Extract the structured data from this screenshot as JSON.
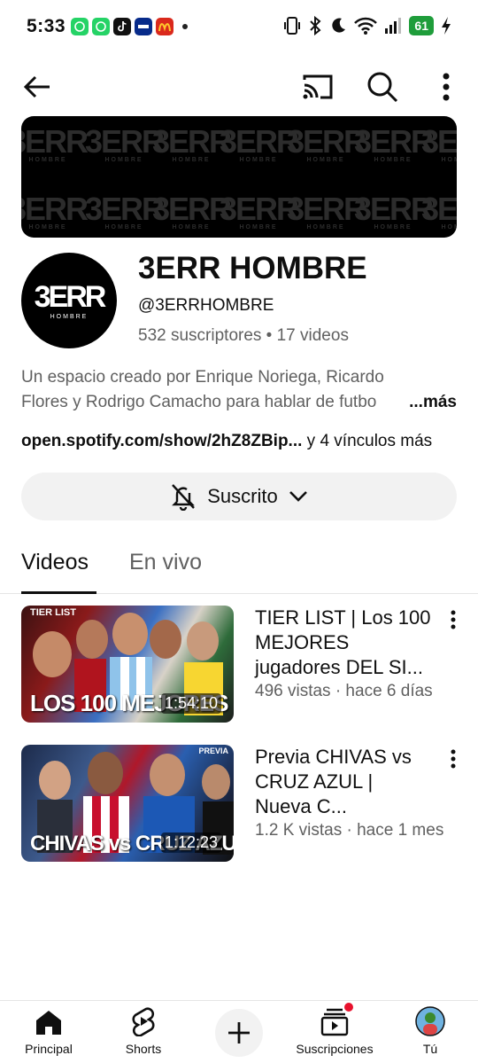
{
  "status_bar": {
    "time": "5:33",
    "battery": "61"
  },
  "channel": {
    "banner_logo": "3ERR",
    "banner_sub": "HOMBRE",
    "avatar_logo": "3ERR",
    "avatar_sub": "HOMBRE",
    "name": "3ERR HOMBRE",
    "handle": "@3ERRHOMBRE",
    "stats": "532 suscriptores • 17 videos",
    "description_line1": "Un espacio creado por Enrique Noriega, Ricardo",
    "description_line2": "Flores y Rodrigo Camacho para hablar de futbo",
    "more_label": "...más",
    "link_text": "open.spotify.com/show/2hZ8ZBip...",
    "more_links": " y 4 vínculos más",
    "subscribe_label": "Suscrito"
  },
  "tabs": [
    {
      "label": "Videos",
      "active": true
    },
    {
      "label": "En vivo",
      "active": false
    }
  ],
  "videos": [
    {
      "title": "TIER LIST | Los 100 MEJORES jugadores DEL SI...",
      "meta": "496 vistas · hace 6 días",
      "duration": "1:54:10",
      "thumb_text": "LOS 100 MEJORES",
      "thumb_tag": "TIER LIST"
    },
    {
      "title": "Previa CHIVAS vs CRUZ AZUL | Nueva C...",
      "meta": "1.2 K vistas · hace 1 mes",
      "duration": "1:12:23",
      "thumb_text": "CHIVAS vs CRUZ AZUL",
      "thumb_tag": "PREVIA"
    }
  ],
  "bottom_nav": [
    {
      "label": "Principal",
      "icon": "home-icon"
    },
    {
      "label": "Shorts",
      "icon": "shorts-icon"
    },
    {
      "label": "",
      "icon": "create-icon"
    },
    {
      "label": "Suscripciones",
      "icon": "subscriptions-icon"
    },
    {
      "label": "Tú",
      "icon": "avatar-icon"
    }
  ],
  "colors": {
    "text_primary": "#0f0f0f",
    "text_secondary": "#606060",
    "chip_bg": "#f2f2f2",
    "battery": "#1f9d3b",
    "notification_dot": "#e8112d"
  }
}
